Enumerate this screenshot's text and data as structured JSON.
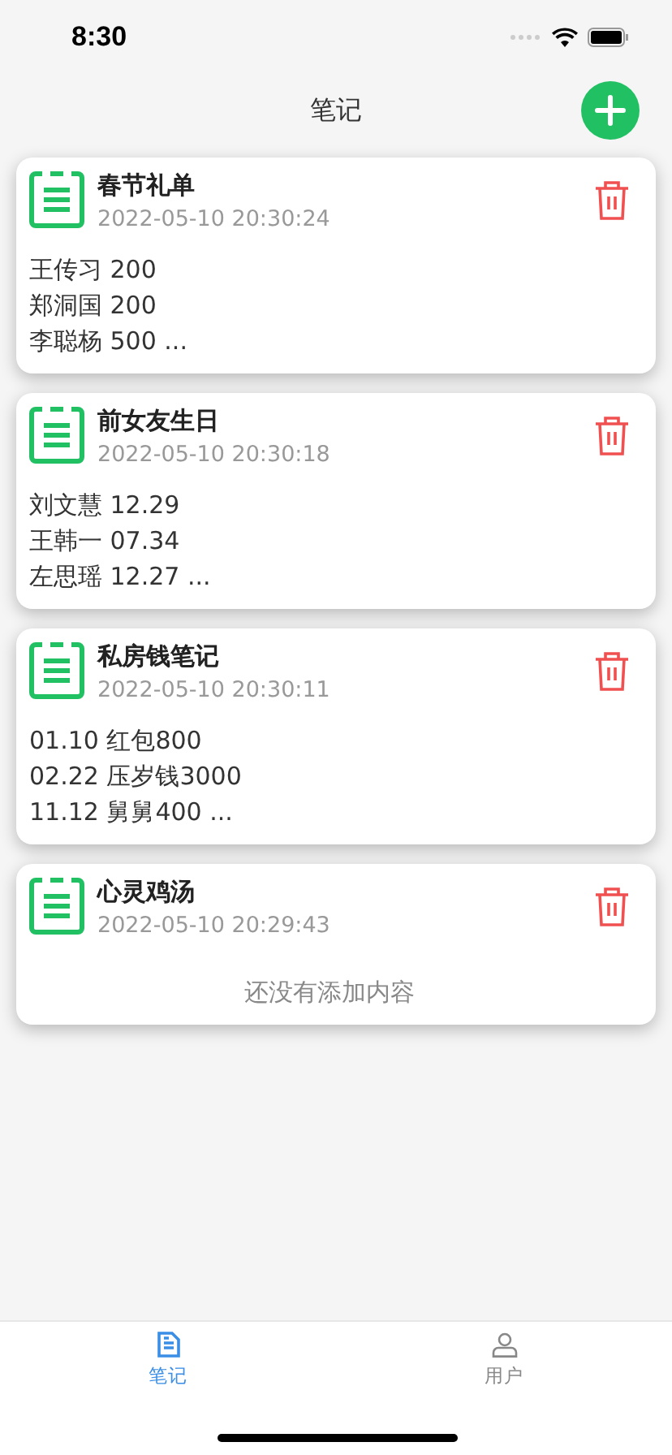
{
  "status_bar": {
    "time": "8:30"
  },
  "header": {
    "title": "笔记"
  },
  "notes": [
    {
      "title": "春节礼单",
      "time": "2022-05-10 20:30:24",
      "lines": [
        "王传习 200",
        "郑洞国 200",
        "李聪杨 500 ..."
      ]
    },
    {
      "title": "前女友生日",
      "time": "2022-05-10 20:30:18",
      "lines": [
        "刘文慧 12.29",
        "王韩一 07.34",
        "左思瑶 12.27 ..."
      ]
    },
    {
      "title": "私房钱笔记",
      "time": "2022-05-10 20:30:11",
      "lines": [
        "01.10 红包800",
        "02.22 压岁钱3000",
        "11.12 舅舅400 ..."
      ]
    },
    {
      "title": "心灵鸡汤",
      "time": "2022-05-10 20:29:43",
      "empty_text": "还没有添加内容"
    }
  ],
  "tabs": [
    {
      "label": "笔记",
      "kind": "notes",
      "selected": true
    },
    {
      "label": "用户",
      "kind": "user",
      "selected": false
    }
  ]
}
